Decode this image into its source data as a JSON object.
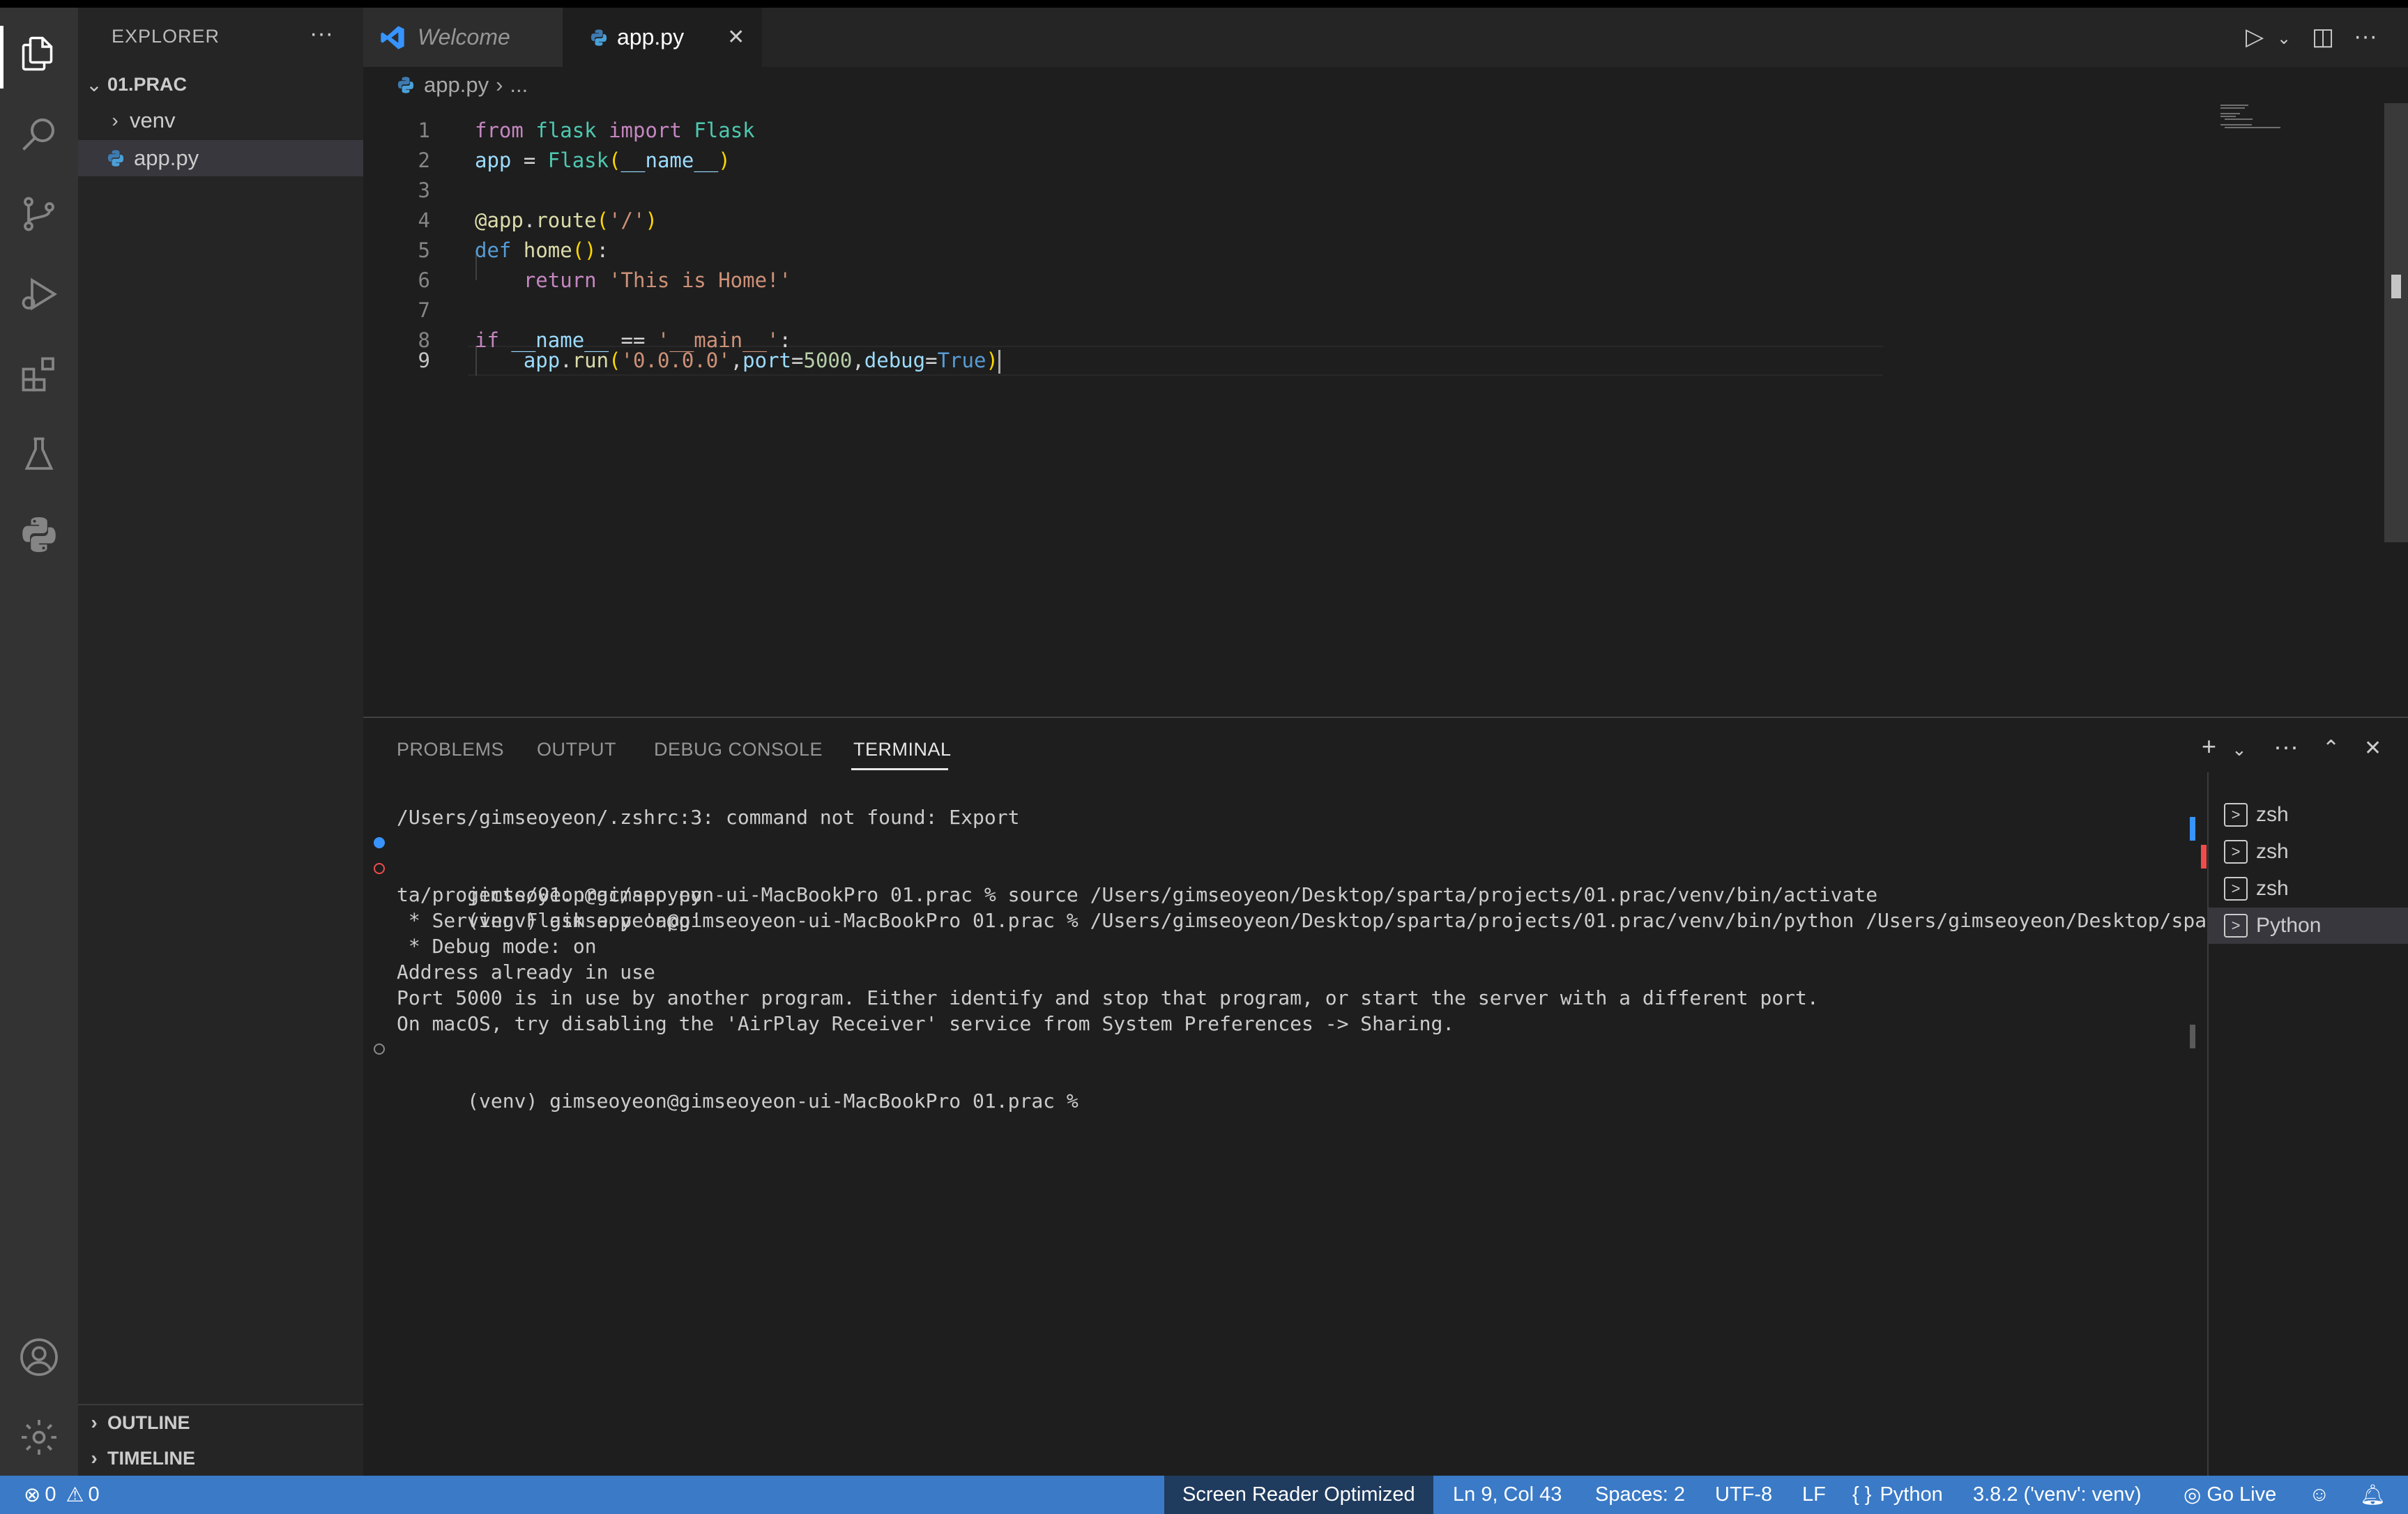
{
  "sidebar": {
    "title": "EXPLORER",
    "more": "···",
    "root": "01.PRAC",
    "items": [
      {
        "label": "venv",
        "type": "folder"
      },
      {
        "label": "app.py",
        "type": "file"
      }
    ],
    "outline_label": "OUTLINE",
    "timeline_label": "TIMELINE"
  },
  "tabs": [
    {
      "label": "Welcome",
      "active": false
    },
    {
      "label": "app.py",
      "active": true
    }
  ],
  "tab_close": "✕",
  "breadcrumb": {
    "file": "app.py",
    "sep": "›",
    "rest": "..."
  },
  "editor": {
    "line_numbers": [
      "1",
      "2",
      "3",
      "4",
      "5",
      "6",
      "7",
      "8",
      "9"
    ],
    "lines": [
      "from flask import Flask",
      "app = Flask(__name__)",
      "",
      "@app.route('/')",
      "def home():",
      "    return 'This is Home!'",
      "",
      "if __name__ == '__main__':",
      "    app.run('0.0.0.0',port=5000,debug=True)"
    ],
    "current_line": 9
  },
  "panel": {
    "tabs": [
      "PROBLEMS",
      "OUTPUT",
      "DEBUG CONSOLE",
      "TERMINAL"
    ],
    "active_tab": "TERMINAL",
    "terminal_lines": [
      "/Users/gimseoyeon/.zshrc:3: command not found: Export",
      "gimseoyeon@gimseoyeon-ui-MacBookPro 01.prac % source /Users/gimseoyeon/Desktop/sparta/projects/01.prac/venv/bin/activate",
      "(venv) gimseoyeon@gimseoyeon-ui-MacBookPro 01.prac % /Users/gimseoyeon/Desktop/sparta/projects/01.prac/venv/bin/python /Users/gimseoyeon/Desktop/spar",
      "ta/projects/01.prac/app.py",
      " * Serving Flask app 'app'",
      " * Debug mode: on",
      "Address already in use",
      "Port 5000 is in use by another program. Either identify and stop that program, or start the server with a different port.",
      "On macOS, try disabling the 'AirPlay Receiver' service from System Preferences -> Sharing.",
      "(venv) gimseoyeon@gimseoyeon-ui-MacBookPro 01.prac % "
    ],
    "terminals": [
      "zsh",
      "zsh",
      "zsh",
      "Python"
    ],
    "selected_terminal": "Python",
    "term_box_glyph": ">"
  },
  "statusbar": {
    "errors": "0",
    "warnings": "0",
    "screen_reader": "Screen Reader Optimized",
    "position": "Ln 9, Col 43",
    "spaces": "Spaces: 2",
    "encoding": "UTF-8",
    "eol": "LF",
    "language": "Python",
    "interpreter": "3.8.2 ('venv': venv)",
    "golive": "Go Live"
  },
  "colors": {
    "accent": "#3a7ac7",
    "editor_bg": "#1e1e1e",
    "sidebar_bg": "#252526",
    "activity_bg": "#333333",
    "error_dot": "#f14c4c",
    "info_dot": "#3794ff"
  },
  "icons": [
    "files-icon",
    "search-icon",
    "source-control-icon",
    "run-debug-icon",
    "extensions-icon",
    "testing-icon",
    "python-icon",
    "account-icon",
    "settings-icon"
  ]
}
